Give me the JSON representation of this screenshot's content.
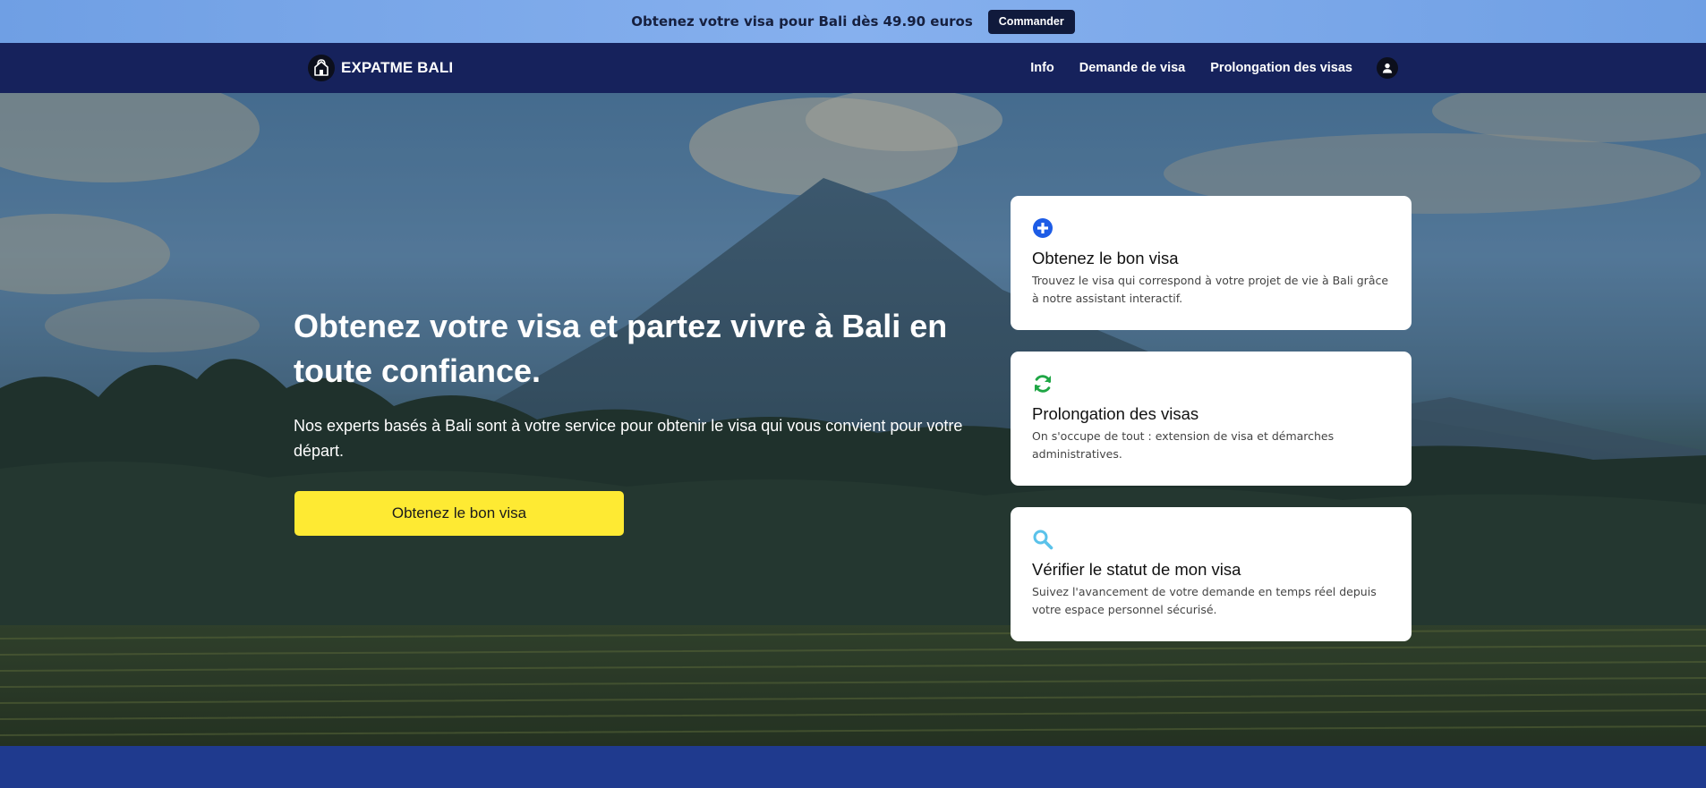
{
  "promo": {
    "text": "Obtenez votre visa pour Bali dès 49.90 euros",
    "button": "Commander"
  },
  "nav": {
    "logo": "EXPATME BALI",
    "links": [
      "Info",
      "Demande de visa",
      "Prolongation des visas"
    ],
    "user_icon": "user-icon"
  },
  "hero": {
    "title": "Obtenez votre visa et partez vivre à Bali en toute confiance.",
    "subtitle": "Nos experts basés à Bali sont à votre service pour obtenir le visa qui vous convient pour votre départ.",
    "cta": "Obtenez le bon visa"
  },
  "cards": [
    {
      "icon": "plus-circle-icon",
      "color": "#1d5ce6",
      "title": "Obtenez le bon visa",
      "desc": "Trouvez le visa qui correspond à votre projet de vie à Bali grâce à notre assistant interactif."
    },
    {
      "icon": "refresh-icon",
      "color": "#1fa645",
      "title": "Prolongation des visas",
      "desc": "On s'occupe de tout : extension de visa et démarches administratives."
    },
    {
      "icon": "search-icon",
      "color": "#5ac2ea",
      "title": "Vérifier le statut de mon visa",
      "desc": "Suivez l'avancement de votre demande en temps réel depuis votre espace personnel sécurisé."
    }
  ],
  "colors": {
    "banner": "#7aa8ea",
    "nav": "#16225c",
    "cta": "#feea33",
    "footer": "#1f3a8e"
  }
}
